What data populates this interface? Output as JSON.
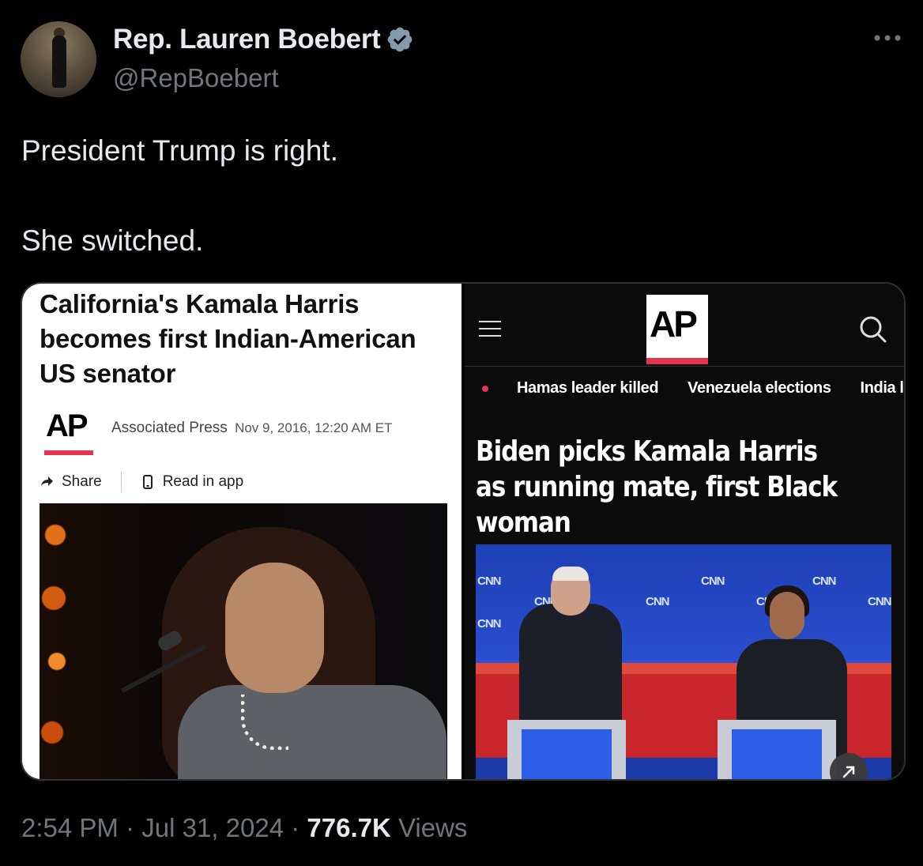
{
  "author": {
    "display_name": "Rep. Lauren Boebert",
    "handle": "@RepBoebert",
    "verified_badge_color": "#829aab"
  },
  "tweet": {
    "lines": [
      "President Trump is right.",
      "She switched."
    ]
  },
  "media_left": {
    "headline": "California's Kamala Harris becomes first Indian-American US senator",
    "logo_text": "AP",
    "source": "Associated Press",
    "date": "Nov 9, 2016, 12:20 AM ET",
    "share_label": "Share",
    "read_in_app_label": "Read in app"
  },
  "media_right": {
    "logo_text": "AP",
    "topics": [
      "Hamas leader killed",
      "Venezuela elections",
      "India la"
    ],
    "headline": "Biden picks Kamala Harris as running mate, first Black woman",
    "stage_logo_text": "CNN"
  },
  "footer": {
    "time": "2:54 PM",
    "separator": "·",
    "date": "Jul 31, 2024",
    "views_count": "776.7K",
    "views_label": "Views"
  },
  "colors": {
    "background": "#000000",
    "text_primary": "#e7e9ea",
    "text_secondary": "#71767b",
    "ap_red": "#e5334d"
  }
}
